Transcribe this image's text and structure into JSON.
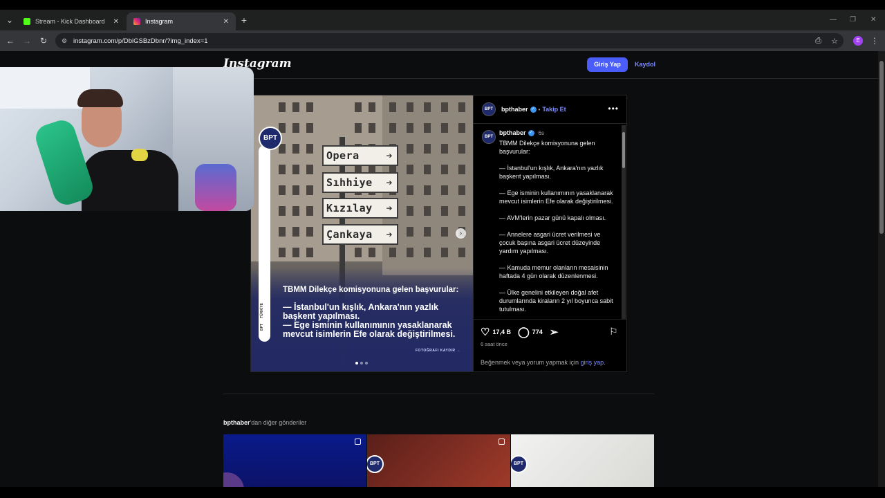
{
  "browser": {
    "tabs": [
      {
        "title": "Stream - Kick Dashboard",
        "favicon_color": "#53fc18",
        "active": false
      },
      {
        "title": "Instagram",
        "favicon_color": "#e1306c",
        "active": true
      }
    ],
    "new_tab": "+",
    "url": "instagram.com/p/DbiGSBzDbnr/?img_index=1",
    "profile_initial": "E"
  },
  "header": {
    "logo": "Instagram",
    "login_label": "Giriş Yap",
    "signup_label": "Kaydol"
  },
  "post": {
    "username": "bpthaber",
    "avatar_text": "BPT",
    "follow_label": "Takip Et",
    "follow_separator": "•",
    "caption_time": "6s",
    "caption_lines": [
      "TBMM Dilekçe komisyonuna gelen başvurular:",
      "— İstanbul'un kışlık, Ankara'nın yazlık başkent yapılması.",
      "— Ege isminin kullanımının yasaklanarak mevcut isimlerin Efe olarak değiştirilmesi.",
      "— AVM'lerin pazar günü kapalı olması.",
      "— Annelere asgari ücret verilmesi ve çocuk başına asgari ücret düzeyinde yardım yapılması.",
      "— Kamuda memur olanların mesaisinin haftada 4 gün olarak düzenlenmesi.",
      "— Ülke genelini etkileyen doğal afet durumlarında kiraların 2 yıl boyunca sabit tutulması."
    ],
    "likes": "17,4 B",
    "comments": "774",
    "time_ago": "6 saat önce",
    "login_hint_prefix": "Beğenmek veya yorum yapmak için ",
    "login_hint_link": "giriş yap",
    "login_hint_suffix": ".",
    "media": {
      "signs": [
        "Opera",
        "Sıhhiye",
        "Kızılay",
        "Çankaya"
      ],
      "headline": "TBMM Dilekçe komisyonuna gelen başvurular:",
      "line1": "— İstanbul'un kışlık, Ankara'nın yazlık",
      "line1b": "başkent yapılması.",
      "line2": "— Ege isminin kullanımının yasaklanarak",
      "line2b": "mevcut isimlerin Efe olarak değiştirilmesi.",
      "swipe_hint": "FOTOĞRAFI KAYDIR →",
      "side_label": "BPT",
      "side_label2": "TÜRKİYE"
    }
  },
  "more_posts": {
    "username": "bpthaber",
    "suffix": "'dan diğer gönderiler"
  }
}
